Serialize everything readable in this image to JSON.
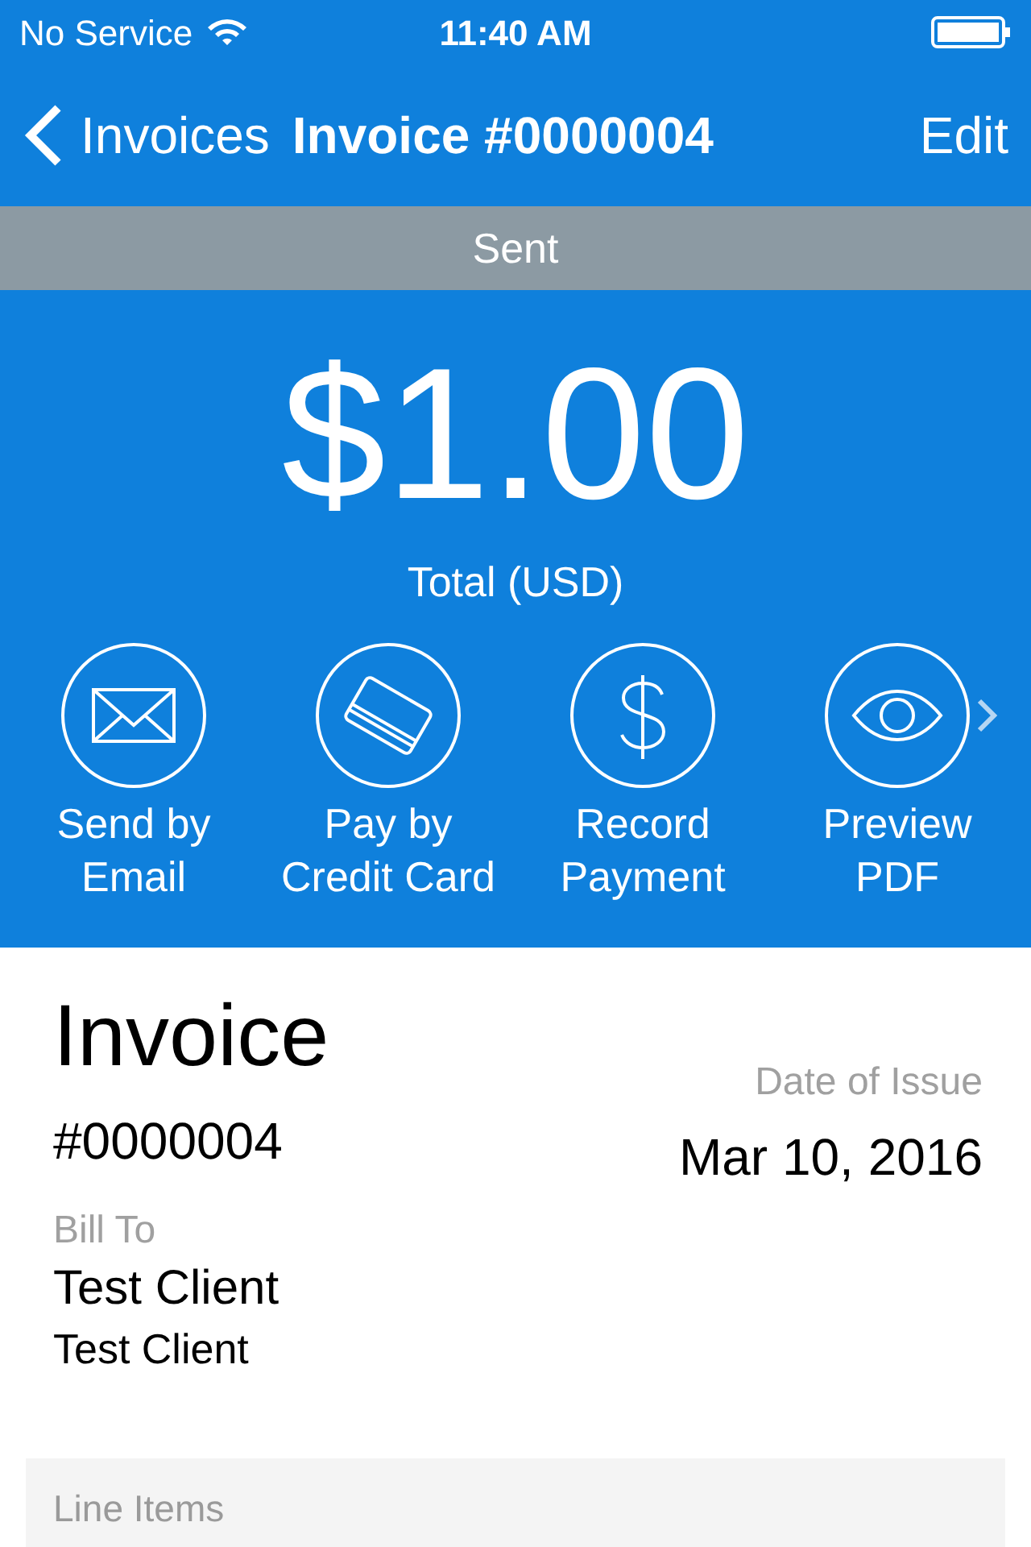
{
  "status_bar": {
    "carrier": "No Service",
    "time": "11:40 AM"
  },
  "nav": {
    "back": "Invoices",
    "title": "Invoice #0000004",
    "action": "Edit"
  },
  "status_banner": "Sent",
  "total": {
    "amount": "$1.00",
    "label": "Total (USD)"
  },
  "actions": [
    {
      "kind": "email",
      "line1": "Send by",
      "line2": "Email"
    },
    {
      "kind": "card",
      "line1": "Pay by",
      "line2": "Credit Card"
    },
    {
      "kind": "dollar",
      "line1": "Record",
      "line2": "Payment"
    },
    {
      "kind": "preview",
      "line1": "Preview",
      "line2": "PDF"
    }
  ],
  "invoice": {
    "heading": "Invoice",
    "number": "#0000004",
    "date_label": "Date of Issue",
    "date": "Mar 10, 2016",
    "bill_to_label": "Bill To",
    "client_name": "Test Client",
    "client_detail": "Test Client"
  },
  "line_items": {
    "label": "Line Items"
  }
}
